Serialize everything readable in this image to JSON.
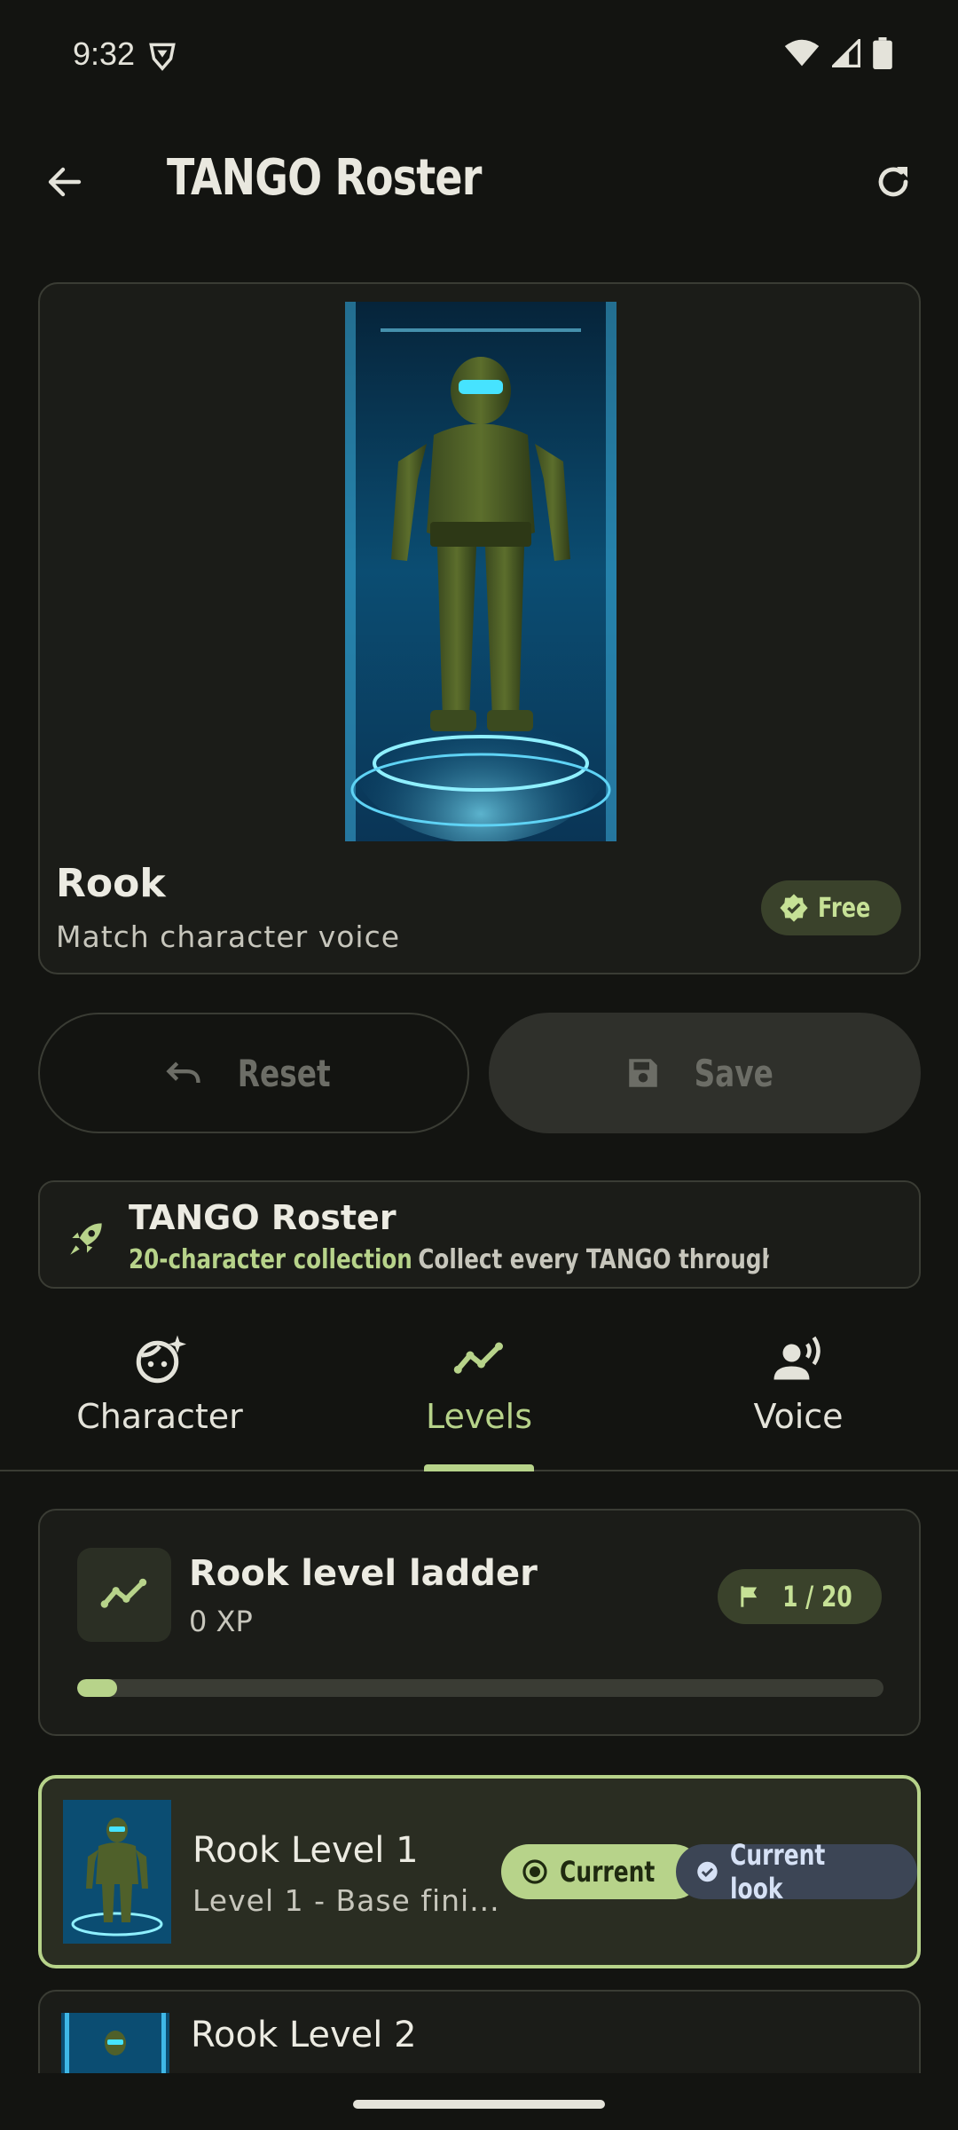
{
  "status_bar": {
    "time": "9:32"
  },
  "header": {
    "title": "TANGO Roster"
  },
  "hero": {
    "name": "Rook",
    "subtitle": "Match character voice",
    "badge": "Free"
  },
  "actions": {
    "reset_label": "Reset",
    "save_label": "Save"
  },
  "promo": {
    "title": "TANGO Roster",
    "accent": "20-character collection",
    "description": "Collect every TANGO through th..."
  },
  "tabs": [
    {
      "label": "Character",
      "icon": "face-icon",
      "active": false
    },
    {
      "label": "Levels",
      "icon": "trend-icon",
      "active": true
    },
    {
      "label": "Voice",
      "icon": "voice-icon",
      "active": false
    }
  ],
  "ladder": {
    "title": "Rook level ladder",
    "xp": "0 XP",
    "badge": "1 / 20",
    "progress": 0.05
  },
  "levels": [
    {
      "name": "Rook Level 1",
      "description": "Level 1 - Base fini...",
      "chip_current": "Current",
      "chip_look": "Current look"
    },
    {
      "name": "Rook Level 2"
    }
  ],
  "colors": {
    "accent": "#b7d38a",
    "background": "#131411",
    "card": "#1b1c18",
    "look_chip": "#3c4555"
  }
}
